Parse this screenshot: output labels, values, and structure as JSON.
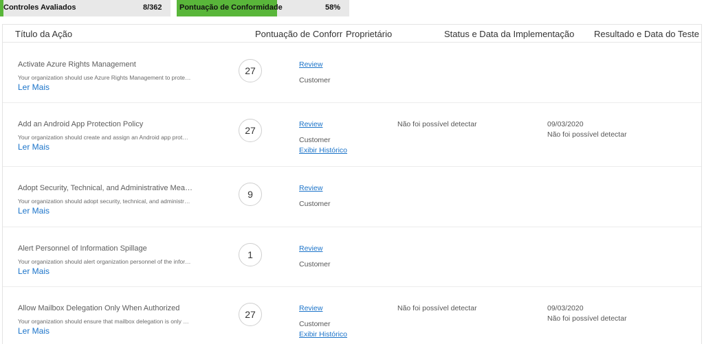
{
  "stats": {
    "evaluated": {
      "label": "Controles Avaliados",
      "value": "8/362",
      "progress": 0.022
    },
    "compliance": {
      "label": "Pontuação de Conformidade",
      "value": "58%",
      "progress": 0.58
    }
  },
  "table": {
    "headers": {
      "title": "Título da Ação",
      "score": "Pontuação de Conformidade",
      "owner": "Proprietário",
      "status": "Status e Data da Implementação",
      "result": "Resultado e Data do Teste"
    },
    "rows": [
      {
        "title": "Activate Azure Rights Management",
        "description": "Your organization should use Azure Rights Management to protect sensitive data",
        "more": "Ler Mais",
        "score": "27",
        "review": "Review",
        "owner": "Customer",
        "history": "",
        "status": "",
        "result_date": "",
        "result": ""
      },
      {
        "title": "Add an Android App Protection Policy",
        "description": "Your organization should create and assign an Android app protection policy",
        "more": "Ler Mais",
        "score": "27",
        "review": "Review",
        "owner": "Customer",
        "history": "Exibir Histórico",
        "status": "Não foi possível detectar",
        "result_date": "09/03/2020",
        "result": "Não foi possível detectar"
      },
      {
        "title": "Adopt Security, Technical, and Administrative Measures",
        "description": "Your organization should adopt security, technical, and administrative measures",
        "more": "Ler Mais",
        "score": "9",
        "review": "Review",
        "owner": "Customer",
        "history": "",
        "status": "",
        "result_date": "",
        "result": ""
      },
      {
        "title": "Alert Personnel of Information Spillage",
        "description": "Your organization should alert organization personnel of the information spillage",
        "more": "Ler Mais",
        "score": "1",
        "review": "Review",
        "owner": "Customer",
        "history": "",
        "status": "",
        "result_date": "",
        "result": ""
      },
      {
        "title": "Allow Mailbox Delegation Only When Authorized",
        "description": "Your organization should ensure that mailbox delegation is only allowed when authorized",
        "more": "Ler Mais",
        "score": "27",
        "review": "Review",
        "owner": "Customer",
        "history": "Exibir Histórico",
        "status": "Não foi possível detectar",
        "result_date": "09/03/2020",
        "result": "Não foi possível detectar"
      }
    ]
  }
}
